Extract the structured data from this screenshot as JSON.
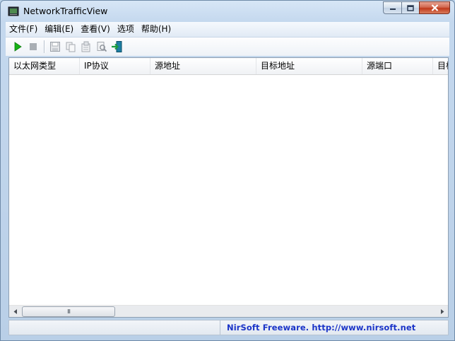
{
  "window": {
    "title": "NetworkTrafficView"
  },
  "menu": {
    "items": [
      "文件(F)",
      "编辑(E)",
      "查看(V)",
      "选项",
      "帮助(H)"
    ]
  },
  "toolbar": {
    "buttons": [
      "play-icon",
      "stop-icon",
      "save-icon",
      "copy-icon",
      "properties-icon",
      "find-icon",
      "exit-icon"
    ]
  },
  "list": {
    "columns": [
      "以太网类型",
      "IP协议",
      "源地址",
      "目标地址",
      "源端口",
      "目标端口"
    ],
    "rows": []
  },
  "scrollbar": {
    "thumb_grip": "III"
  },
  "status": {
    "left_text": "",
    "link_text": "NirSoft Freeware.  http://www.nirsoft.net"
  },
  "colors": {
    "link": "#1a34c8",
    "play": "#17b317",
    "close": "#c0391c"
  }
}
